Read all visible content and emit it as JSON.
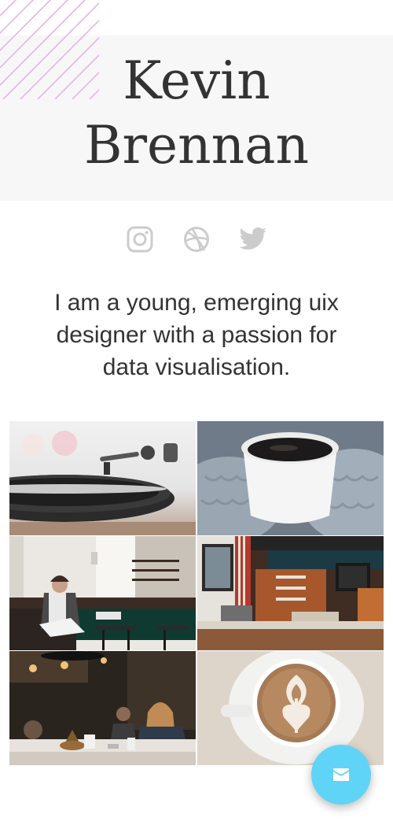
{
  "profile": {
    "first_name": "Kevin",
    "last_name": "Brennan",
    "bio": "I am a young, emerging uix designer with a passion for data visualisation."
  },
  "social": [
    {
      "icon": "instagram-icon"
    },
    {
      "icon": "dribbble-icon"
    },
    {
      "icon": "twitter-icon"
    }
  ],
  "gallery": [
    {
      "subject": "record-player"
    },
    {
      "subject": "coffee-mug-in-knit-mittens"
    },
    {
      "subject": "person-reading-in-cafe"
    },
    {
      "subject": "cafe-counter"
    },
    {
      "subject": "woman-in-cafe"
    },
    {
      "subject": "latte-art"
    }
  ],
  "fab": {
    "icon": "mail-icon"
  },
  "colors": {
    "accent": "#5fd4f6",
    "hero_bg": "#f7f7f7",
    "stripes": "#e6b3e6",
    "icon_gray": "#cccccc",
    "text": "#333333"
  }
}
